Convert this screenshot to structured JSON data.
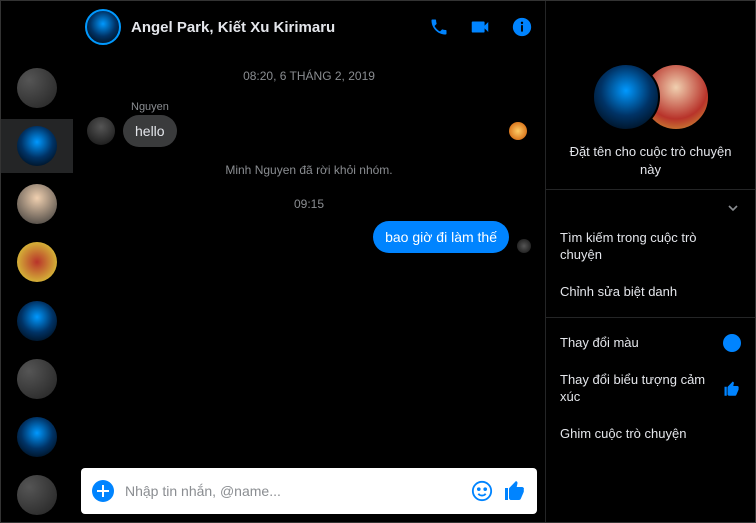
{
  "header": {
    "title": "Angel Park, Kiết Xu Kirimaru"
  },
  "chat": {
    "timestamp_top": "08:20, 6 THÁNG 2, 2019",
    "sender1": "Nguyen",
    "msg1": "hello",
    "system_left": "Minh Nguyen đã rời khỏi nhóm.",
    "timestamp_mid": "09:15",
    "msg_out": "bao giờ đi làm thế"
  },
  "composer": {
    "placeholder": "Nhập tin nhắn, @name..."
  },
  "panel": {
    "name_chat": "Đặt tên cho cuộc trò chuyện này",
    "search": "Tìm kiếm trong cuộc trò chuyện",
    "nicknames": "Chỉnh sửa biệt danh",
    "change_color": "Thay đổi màu",
    "change_emoji": "Thay đổi biểu tượng cảm xúc",
    "pin": "Ghim cuộc trò chuyện"
  }
}
